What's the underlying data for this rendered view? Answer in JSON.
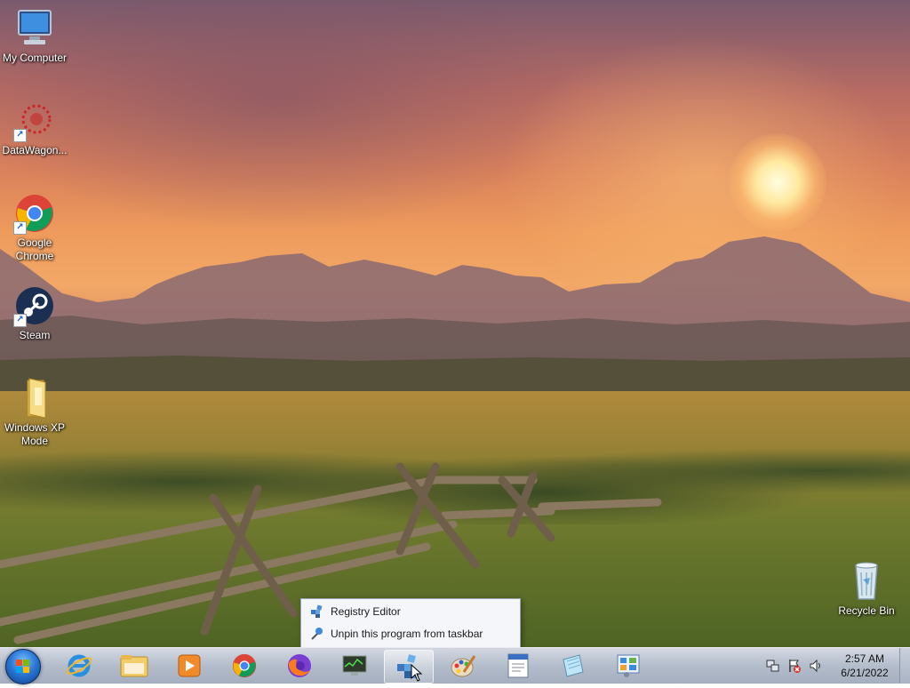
{
  "desktop": {
    "icons": [
      {
        "label": "My Computer",
        "icon": "my-computer-icon"
      },
      {
        "label": "DataWagon...",
        "icon": "datawagon-icon"
      },
      {
        "label": "Google Chrome",
        "icon": "chrome-icon"
      },
      {
        "label": "Steam",
        "icon": "steam-icon"
      },
      {
        "label": "Windows XP Mode",
        "icon": "folder-icon"
      },
      {
        "label": "Recycle Bin",
        "icon": "recycle-bin-icon"
      }
    ]
  },
  "jumplist": {
    "items": [
      {
        "label": "Registry Editor",
        "icon": "registry-editor-icon"
      },
      {
        "label": "Unpin this program from taskbar",
        "icon": "unpin-icon"
      }
    ]
  },
  "taskbar": {
    "start": "start-button",
    "buttons": [
      {
        "name": "internet-explorer",
        "icon": "internet-explorer-icon"
      },
      {
        "name": "windows-explorer",
        "icon": "windows-explorer-icon"
      },
      {
        "name": "media-player",
        "icon": "media-player-icon"
      },
      {
        "name": "google-chrome",
        "icon": "chrome-icon"
      },
      {
        "name": "firefox",
        "icon": "firefox-icon"
      },
      {
        "name": "system-monitor",
        "icon": "system-monitor-icon"
      },
      {
        "name": "registry-editor",
        "icon": "registry-editor-icon",
        "active": true
      },
      {
        "name": "paint",
        "icon": "paint-icon"
      },
      {
        "name": "wordpad",
        "icon": "wordpad-icon"
      },
      {
        "name": "notepad",
        "icon": "notepad-icon"
      },
      {
        "name": "control-panel",
        "icon": "control-panel-icon"
      }
    ],
    "tray": {
      "icons": [
        "network-icon",
        "action-center-icon",
        "volume-icon"
      ],
      "time": "2:57 AM",
      "date": "6/21/2022"
    }
  },
  "colors": {
    "link_blue": "#1a62c5",
    "taskbar_glass": "#b4bdcc"
  }
}
